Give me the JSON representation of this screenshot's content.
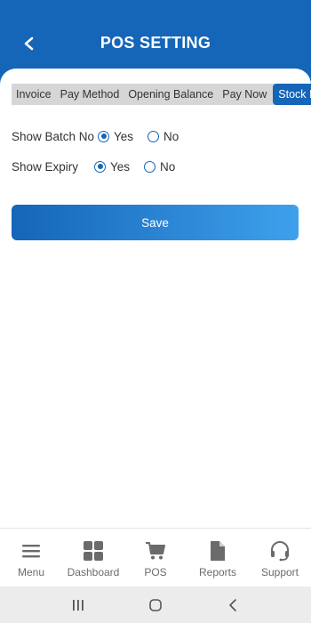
{
  "header": {
    "title": "POS SETTING",
    "back_icon": "chevron-left-icon"
  },
  "tabs": [
    {
      "label": "Invoice",
      "active": false
    },
    {
      "label": "Pay Method",
      "active": false
    },
    {
      "label": "Opening Balance",
      "active": false
    },
    {
      "label": "Pay Now",
      "active": false
    },
    {
      "label": "Stock In",
      "active": true
    }
  ],
  "settings": [
    {
      "label": "Show Batch No",
      "options": [
        "Yes",
        "No"
      ],
      "selected": "Yes"
    },
    {
      "label": "Show Expiry",
      "options": [
        "Yes",
        "No"
      ],
      "selected": "Yes"
    }
  ],
  "save_label": "Save",
  "bottom_nav": [
    {
      "label": "Menu",
      "icon": "menu-icon"
    },
    {
      "label": "Dashboard",
      "icon": "dashboard-icon"
    },
    {
      "label": "POS",
      "icon": "cart-icon"
    },
    {
      "label": "Reports",
      "icon": "document-icon"
    },
    {
      "label": "Support",
      "icon": "headset-icon"
    }
  ],
  "system_nav": [
    "recents-icon",
    "home-icon",
    "back-icon"
  ],
  "colors": {
    "primary": "#1565b8",
    "gradient_end": "#3ea1ec",
    "tab_bg": "#d6d6d6",
    "nav_label": "#6b6b6b"
  }
}
